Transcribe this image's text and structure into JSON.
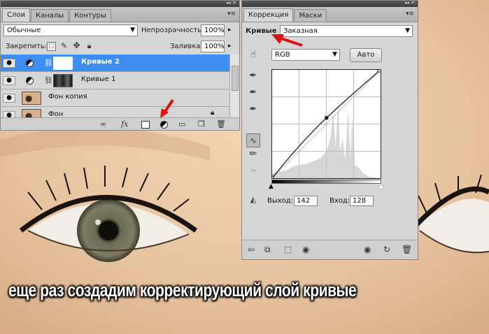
{
  "caption": "еще раз создадим корректирующий слой кривые",
  "layers_panel": {
    "titlebar_controls": "◂◂  ✕",
    "tabs": [
      "Слои",
      "Каналы",
      "Контуры"
    ],
    "menu_icon": "▾≡",
    "blend_mode": "Обычные",
    "opacity_label": "Непрозрачность:",
    "opacity_value": "100%",
    "lock_label": "Закрепить:",
    "fill_label": "Заливка:",
    "fill_value": "100%",
    "layers": [
      {
        "name": "Кривые 2",
        "type": "adjustment",
        "selected": true
      },
      {
        "name": "Кривые 1",
        "type": "adjustment",
        "selected": false
      },
      {
        "name": "Фон копия",
        "type": "image",
        "selected": false
      },
      {
        "name": "Фон",
        "type": "image",
        "selected": false
      }
    ],
    "bottom_icons": [
      "link-icon",
      "fx-icon",
      "mask-icon",
      "adjustment-layer-icon",
      "folder-icon",
      "new-layer-icon",
      "trash-icon"
    ],
    "fx_label": "fx"
  },
  "adjust_panel": {
    "titlebar_controls": "◂◂  ✕",
    "tabs": [
      "Коррекция",
      "Маски"
    ],
    "menu_icon": "▾≡",
    "type_label": "Кривые",
    "preset_value": "Заказная",
    "channel_value": "RGB",
    "auto_label": "Авто",
    "output_label": "Выход:",
    "output_value": "142",
    "input_label": "Вход:",
    "input_value": "128",
    "curve_point": {
      "input": 128,
      "output": 142
    }
  },
  "colors": {
    "selection_blue": "#3d8ef0",
    "arrow_red": "#e01010",
    "panel_gray": "#d6d6d6"
  }
}
